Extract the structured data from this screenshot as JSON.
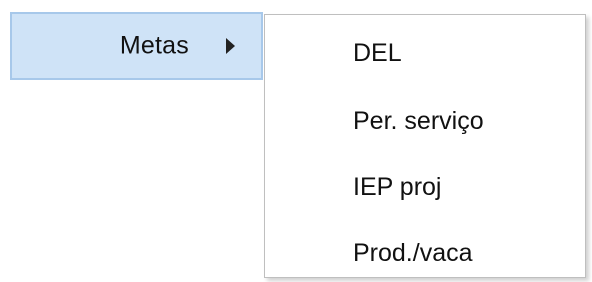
{
  "menu": {
    "metas_label": "Metas",
    "submenu_arrow_icon": "chevron-right-filled",
    "highlight_color": "#cfe3f7"
  },
  "submenu": {
    "items": [
      {
        "label": "DEL"
      },
      {
        "label": "Per. serviço"
      },
      {
        "label": "IEP proj"
      },
      {
        "label": "Prod./vaca"
      }
    ]
  }
}
